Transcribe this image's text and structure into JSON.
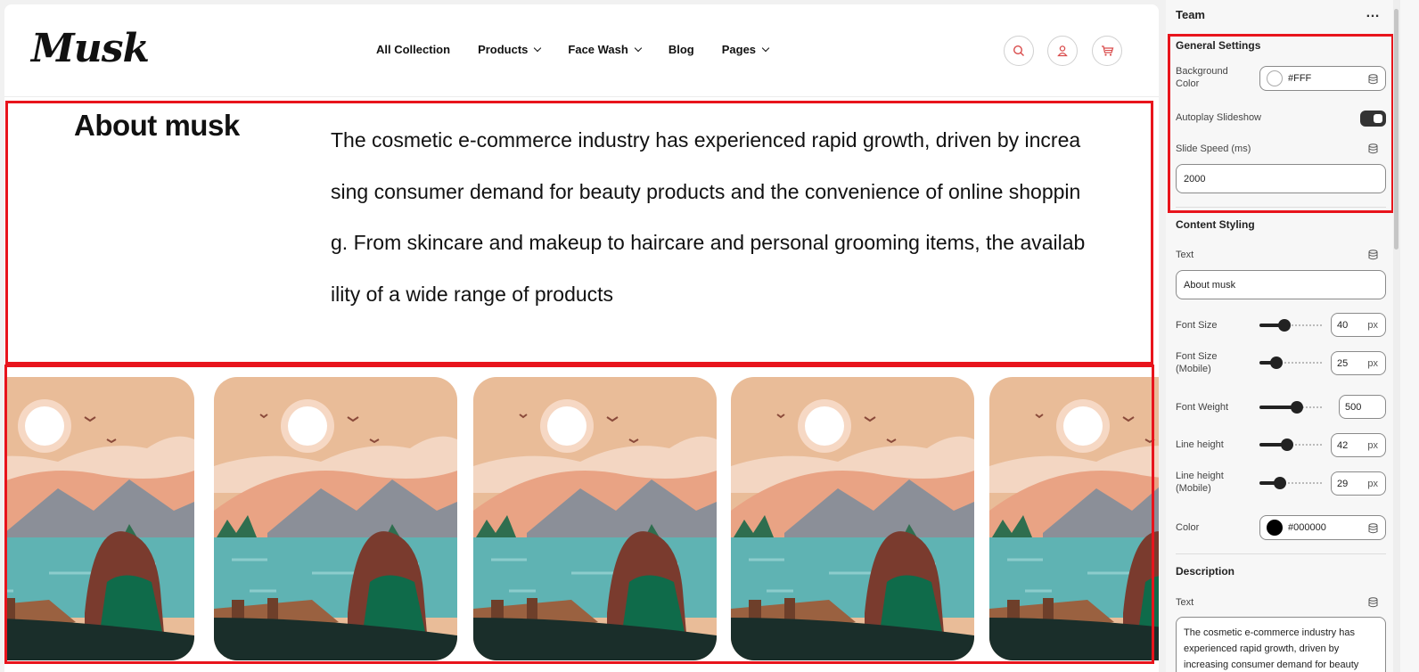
{
  "header": {
    "logo": "Musk",
    "nav": [
      {
        "label": "All Collection",
        "dropdown": false
      },
      {
        "label": "Products",
        "dropdown": true
      },
      {
        "label": "Face Wash",
        "dropdown": true
      },
      {
        "label": "Blog",
        "dropdown": false
      },
      {
        "label": "Pages",
        "dropdown": true
      }
    ],
    "icons": [
      "search-icon",
      "user-icon",
      "cart-icon"
    ]
  },
  "about": {
    "title": "About musk",
    "text": "The cosmetic e-commerce industry has experienced rapid growth, driven by increasing consumer demand for beauty products and the convenience of online shopping. From skincare and makeup to haircare and personal grooming items, the availability of a wide range of products"
  },
  "slides_count": 5,
  "colors": {
    "accent": "#e8141c",
    "icon_red": "#d94b4b",
    "sky": "#e9bc98",
    "water": "#5fb3b3"
  },
  "panel": {
    "title": "Team",
    "more": "…",
    "general_settings": {
      "heading": "General Settings",
      "background_color_label": "Background Color",
      "background_color_value": "#FFF",
      "autoplay_label": "Autoplay Slideshow",
      "autoplay_on": true,
      "slide_speed_label": "Slide Speed (ms)",
      "slide_speed_value": "2000"
    },
    "content_styling": {
      "heading": "Content Styling",
      "text_label": "Text",
      "text_value": "About musk",
      "font_size_label": "Font Size",
      "font_size_value": "40",
      "font_size_mobile_label": "Font Size (Mobile)",
      "font_size_mobile_value": "25",
      "font_weight_label": "Font Weight",
      "font_weight_value": "500",
      "line_height_label": "Line height",
      "line_height_value": "42",
      "line_height_mobile_label": "Line height (Mobile)",
      "line_height_mobile_value": "29",
      "color_label": "Color",
      "color_value": "#000000",
      "unit": "px"
    },
    "description": {
      "heading": "Description",
      "text_label": "Text",
      "text_value": "The cosmetic e-commerce industry has experienced rapid growth, driven by increasing consumer demand for beauty"
    }
  }
}
